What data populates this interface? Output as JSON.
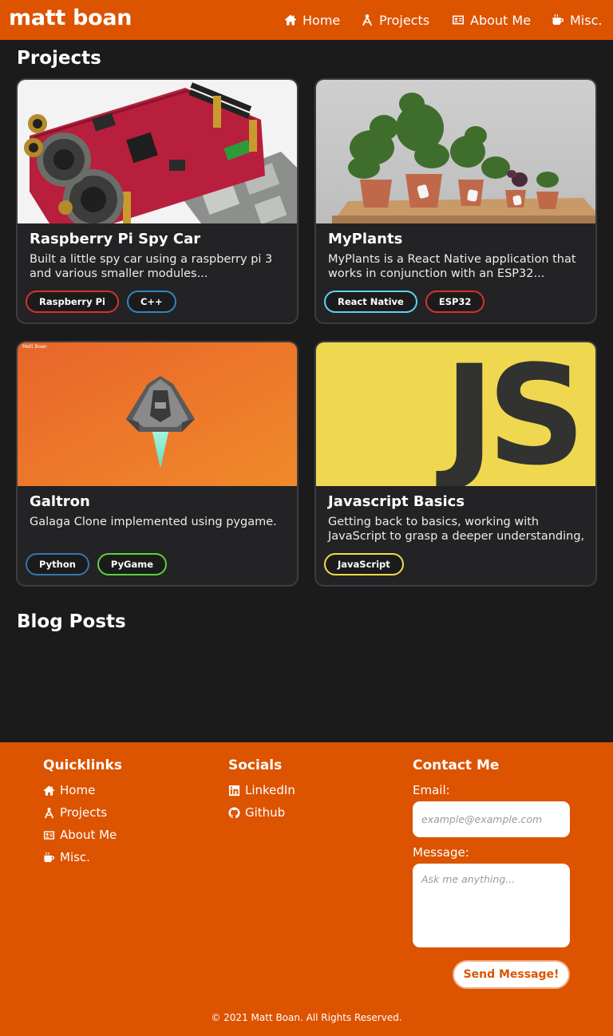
{
  "nav": {
    "brand": "matt boan",
    "items": [
      {
        "label": "Home",
        "icon": "home-icon"
      },
      {
        "label": "Projects",
        "icon": "compass-drafting-icon"
      },
      {
        "label": "About Me",
        "icon": "id-card-icon"
      },
      {
        "label": "Misc.",
        "icon": "coffee-mug-icon"
      }
    ]
  },
  "projects": {
    "title": "Projects",
    "cards": [
      {
        "title": "Raspberry Pi Spy Car",
        "description": "Built a little spy car using a raspberry pi 3 and various smaller modules...",
        "image": "raspberry-pi-board-image",
        "tags": [
          {
            "label": "Raspberry Pi",
            "color": "#d9312b"
          },
          {
            "label": "C++",
            "color": "#2e86c1"
          }
        ]
      },
      {
        "title": "MyPlants",
        "description": "MyPlants is a React Native application that works in conjunction with an ESP32...",
        "image": "potted-plants-image",
        "tags": [
          {
            "label": "React Native",
            "color": "#5ed3f3"
          },
          {
            "label": "ESP32",
            "color": "#d9312b"
          }
        ]
      },
      {
        "title": "Galtron",
        "description": "Galaga Clone implemented using pygame.",
        "image": "spaceship-game-image",
        "image_caption": "Matt Boan",
        "tags": [
          {
            "label": "Python",
            "color": "#3a73b0"
          },
          {
            "label": "PyGame",
            "color": "#5ad43a"
          }
        ]
      },
      {
        "title": "Javascript Basics",
        "description": "Getting back to basics, working with JavaScript to grasp a deeper understanding,",
        "image": "javascript-logo-image",
        "image_text": "JS",
        "tags": [
          {
            "label": "JavaScript",
            "color": "#f0db4f"
          }
        ]
      }
    ]
  },
  "blog": {
    "title": "Blog Posts"
  },
  "footer": {
    "quicklinks": {
      "title": "Quicklinks",
      "items": [
        {
          "label": "Home",
          "icon": "home-icon"
        },
        {
          "label": "Projects",
          "icon": "compass-drafting-icon"
        },
        {
          "label": "About Me",
          "icon": "id-card-icon"
        },
        {
          "label": "Misc.",
          "icon": "coffee-mug-icon"
        }
      ]
    },
    "socials": {
      "title": "Socials",
      "items": [
        {
          "label": "LinkedIn",
          "icon": "linkedin-icon"
        },
        {
          "label": "Github",
          "icon": "github-icon"
        }
      ]
    },
    "contact": {
      "title": "Contact Me",
      "email_label": "Email:",
      "email_placeholder": "example@example.com",
      "email_value": "",
      "message_label": "Message:",
      "message_placeholder": "Ask me anything...",
      "message_value": "",
      "send_label": "Send Message!"
    },
    "copyright": "© 2021 Matt Boan. All Rights Reserved."
  },
  "colors": {
    "accent": "#dc5300",
    "background": "#1b1b1c",
    "card": "#232325"
  }
}
